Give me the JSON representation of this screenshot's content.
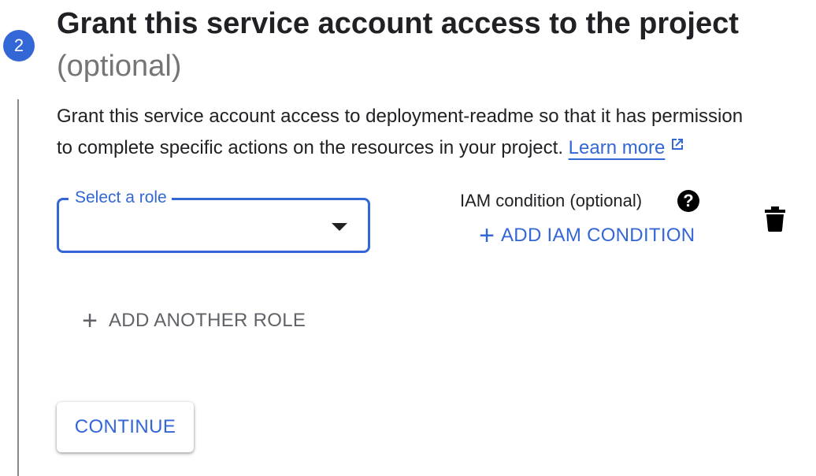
{
  "step": {
    "number": "2",
    "title": "Grant this service account access to the project",
    "subtitle": "(optional)"
  },
  "description": {
    "line1": "Grant this service account access to deployment-readme so that it has permission",
    "line2": "to complete specific actions on the resources in your project.",
    "learn_more": "Learn more",
    "learn_more_icon": "external-link-icon"
  },
  "role_select": {
    "label": "Select a role",
    "value": "",
    "icon": "dropdown-arrow-icon"
  },
  "iam_condition": {
    "label": "IAM condition (optional)",
    "help_icon": "help-icon",
    "add_label": "ADD IAM CONDITION",
    "add_icon": "plus-icon",
    "delete_icon": "trash-icon"
  },
  "add_another_role": {
    "label": "ADD ANOTHER ROLE",
    "icon": "plus-icon"
  },
  "continue_button": {
    "label": "CONTINUE"
  },
  "colors": {
    "accent": "#3367d6",
    "text": "#202124",
    "muted": "#757575",
    "secondary": "#5f6368"
  }
}
